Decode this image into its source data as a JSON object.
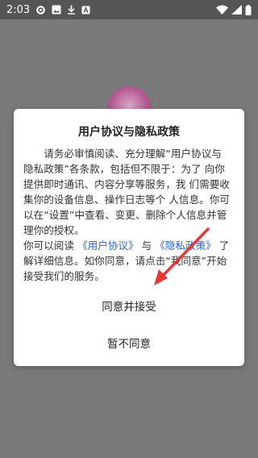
{
  "status_bar": {
    "time": "2:03",
    "icons": [
      "settings-icon",
      "image-icon",
      "download-icon",
      "app-notification-icon",
      "wifi-icon",
      "signal-icon",
      "battery-icon"
    ]
  },
  "dialog": {
    "title": "用户协议与隐私政策",
    "p1": "请务必审慎阅读、充分理解“用户协议与 隐私政策”各条款，包括但不限于：为了 向你提供即时通讯、内容分享等服务，我 们需要收集你的设备信息、操作日志等个 人信息。你可以在“设置”中查看、变更、删除个人信息并管理你的授权。",
    "p2_prefix": "你可以阅读 ",
    "link_user_agreement": "《用户协议》",
    "p2_and": " 与 ",
    "link_privacy_policy": "《隐私政策》",
    "p2_suffix": " 了解详细信息。如你同意，请点击“我同意”开始接受我们的服务。",
    "agree_label": "同意并接受",
    "disagree_label": "暂不同意"
  },
  "colors": {
    "overlay": "#7a7a7a",
    "status_bar": "#555555",
    "link": "#2a63d8",
    "arrow": "#e53935"
  }
}
